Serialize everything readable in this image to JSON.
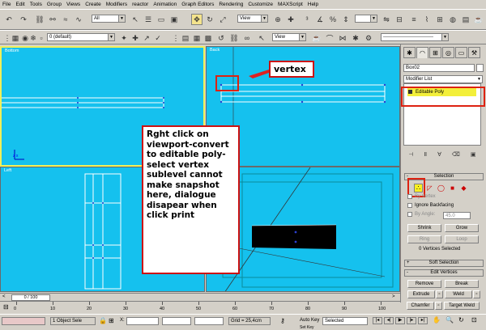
{
  "menu": [
    "File",
    "Edit",
    "Tools",
    "Group",
    "Views",
    "Create",
    "Modifiers",
    "reactor",
    "Animation",
    "Graph Editors",
    "Rendering",
    "Customize",
    "MAXScript",
    "Help"
  ],
  "toolbar": {
    "selection_filter": "All",
    "ref_coord": "View",
    "named_selection": "",
    "layer": "0 (default)",
    "view2": "View"
  },
  "viewports": {
    "top_left": "Bottom",
    "top_right": "Back",
    "bottom_left": "Left",
    "bottom_right": ""
  },
  "annotations": {
    "vertex_label": "vertex",
    "note": "Rght click on viewport-convert to editable poly-select vertex sublevel cannot make snapshot here, dialogue disapear  when click print"
  },
  "command_panel": {
    "object_name": "Box02",
    "modifier_list": "Modifier List",
    "stack_item": "Editable Poly",
    "selection_rollout": "Selection",
    "by_vertex": "By Vertex",
    "ignore_backfacing": "Ignore Backfacing",
    "by_angle_label": "By Angle:",
    "by_angle_value": "45.0",
    "shrink": "Shrink",
    "grow": "Grow",
    "ring": "Ring",
    "loop": "Loop",
    "selected_status": "0 Vertices Selected",
    "soft_selection": "Soft Selection",
    "edit_vertices": "Edit Vertices",
    "remove": "Remove",
    "break": "Break",
    "extrude": "Extrude",
    "weld": "Weld",
    "chamfer": "Chamfer",
    "target_weld": "Target Weld"
  },
  "timeline": {
    "slider": "0 / 100",
    "ticks": [
      "0",
      "10",
      "20",
      "30",
      "40",
      "50",
      "60",
      "70",
      "80",
      "90",
      "100"
    ]
  },
  "status": {
    "selection_count": "1 Object Sele",
    "x_label": "X:",
    "grid": "Grid = 25,4cm",
    "auto_key": "Auto Key",
    "set_key": "Set Key",
    "key_filter": "Selected"
  },
  "colors": {
    "viewport_bg": "#15c1ee",
    "highlight_red": "#d21111",
    "stack_yellow": "#f3ef3a"
  }
}
